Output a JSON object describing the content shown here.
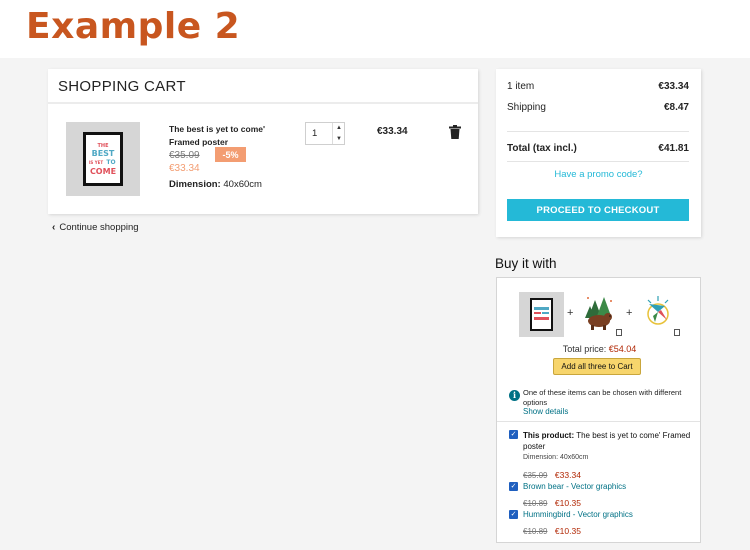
{
  "example_title": "Example 2",
  "cart": {
    "title": "SHOPPING CART",
    "item": {
      "name": "The best is yet to come' Framed poster",
      "old_price": "€35.09",
      "discount": "-5%",
      "new_price": "€33.34",
      "dimension_label": "Dimension:",
      "dimension_value": "40x60cm",
      "quantity": "1",
      "line_total": "€33.34",
      "poster_text": [
        "THE",
        "BEST",
        "IS YET",
        "TO",
        "COME"
      ]
    },
    "continue_label": "Continue shopping"
  },
  "summary": {
    "items_label": "1 item",
    "items_value": "€33.34",
    "shipping_label": "Shipping",
    "shipping_value": "€8.47",
    "total_label": "Total (tax incl.)",
    "total_value": "€41.81",
    "promo_label": "Have a promo code?",
    "checkout_label": "PROCEED TO CHECKOUT"
  },
  "buy_it_with": {
    "heading": "Buy it with",
    "total_label": "Total price:",
    "total_value": "€54.04",
    "add_button": "Add all three to Cart",
    "info_text": "One of these items can be chosen with different options",
    "show_details": "Show details",
    "options": [
      {
        "prefix": "This product:",
        "name": "The best is yet to come' Framed poster",
        "dimension": "Dimension: 40x60cm",
        "old_price": "€35.09",
        "new_price": "€33.34"
      },
      {
        "name": "Brown bear - Vector graphics",
        "old_price": "€10.89",
        "new_price": "€10.35"
      },
      {
        "name": "Hummingbird - Vector graphics",
        "old_price": "€10.89",
        "new_price": "€10.35"
      }
    ]
  },
  "colors": {
    "accent": "#24b9d7",
    "discount": "#f39d72",
    "title": "#c8561f",
    "price_red": "#b12704"
  }
}
